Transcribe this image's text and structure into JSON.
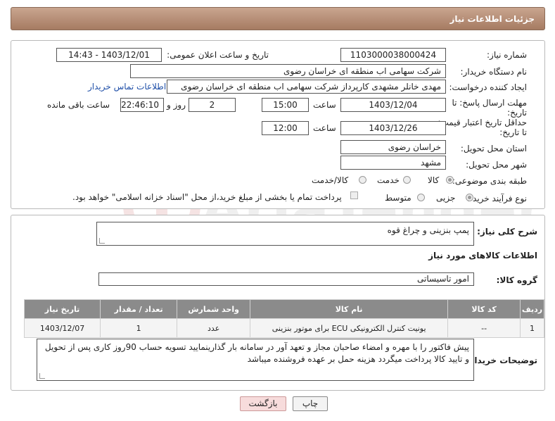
{
  "header": {
    "title": "جزئیات اطلاعات نیاز"
  },
  "form": {
    "need_number_label": "شماره نیاز:",
    "need_number": "1103000038000424",
    "announce_label": "تاریخ و ساعت اعلان عمومی:",
    "announce_value": "1403/12/01 - 14:43",
    "buyer_label": "نام دستگاه خریدار:",
    "buyer_value": "شرکت سهامی اب منطقه ای خراسان رضوی",
    "creator_label": "ایجاد کننده درخواست:",
    "creator_value": "مهدی خانلر مشهدی کارپرداز شرکت سهامی اب منطقه ای خراسان رضوی",
    "contact_link": "اطلاعات تماس خریدار",
    "deadline_label": "مهلت ارسال پاسخ: تا تاریخ:",
    "deadline_date": "1403/12/04",
    "time_label": "ساعت",
    "deadline_time": "15:00",
    "days_value": "2",
    "days_label": "روز و",
    "remaining_value": "22:46:10",
    "remaining_label": "ساعت باقی مانده",
    "validity_label": "حداقل تاریخ اعتبار قیمت: تا تاریخ:",
    "validity_date": "1403/12/26",
    "validity_time": "12:00",
    "province_label": "استان محل تحویل:",
    "province_value": "خراسان رضوی",
    "city_label": "شهر محل تحویل:",
    "city_value": "مشهد",
    "category_label": "طبقه بندی موضوعی:",
    "category_options": [
      "کالا",
      "خدمت",
      "کالا/خدمت"
    ],
    "process_label": "نوع فرآیند خرید :",
    "process_options": [
      "جزیی",
      "متوسط"
    ],
    "payment_note": "پرداخت تمام یا بخشی از مبلغ خرید،از محل \"اسناد خزانه اسلامی\" خواهد بود."
  },
  "description": {
    "label": "شرح کلی نیاز:",
    "value": "پمپ بنزینی و چراغ قوه",
    "goods_info_title": "اطلاعات کالاهای مورد نیاز",
    "goods_group_label": "گروه کالا:",
    "goods_group_value": "امور تاسیساتی"
  },
  "table": {
    "headers": [
      "ردیف",
      "کد کالا",
      "نام کالا",
      "واحد شمارش",
      "تعداد / مقدار",
      "تاریخ نیاز"
    ],
    "rows": [
      [
        "1",
        "--",
        "یونیت کنترل الکترونیکی ECU برای موتور بنزینی",
        "عدد",
        "1",
        "1403/12/07"
      ]
    ]
  },
  "notes": {
    "label": "توضیحات خریدار:",
    "value": "پیش فاکتور را با مهره و امضاء صاحبان مجاز و تعهد آور در سامانه بار گذارینمایید  تسویه  حساب 90روز کاری پس از تحویل و تایید کالا پرداخت میگردد هزینه حمل بر عهده فروشنده میباشد"
  },
  "buttons": {
    "print": "چاپ",
    "back": "بازگشت"
  },
  "watermark": {
    "text": "AriaTender.net"
  },
  "colors": {
    "header": "#b08a72",
    "link": "#1f4fa8",
    "table_header": "#8b8b8b",
    "back_button": "#f7dcdc"
  }
}
